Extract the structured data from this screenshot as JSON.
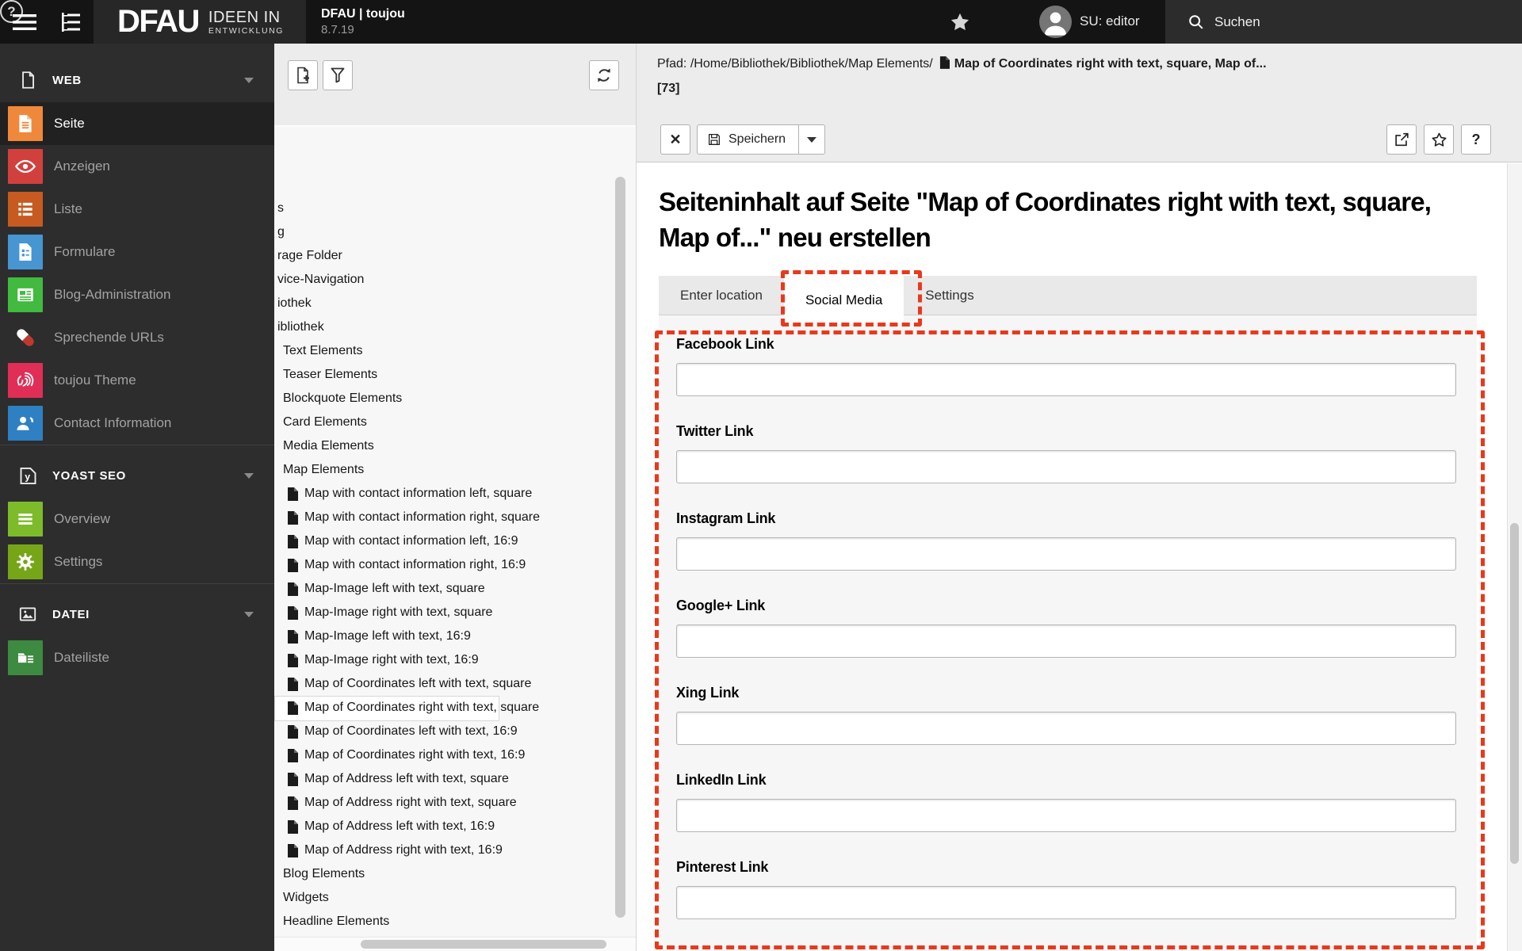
{
  "colors": {
    "annotation_red": "#e8391d"
  },
  "topbar": {
    "logo": {
      "brand": "DFAU",
      "tagline_line1": "IDEEN IN",
      "tagline_line2": "ENTWICKLUNG"
    },
    "site_title": "DFAU | toujou",
    "version": "8.7.19",
    "user_label": "SU: editor",
    "help_glyph": "?",
    "search_label": "Suchen"
  },
  "module_menu": {
    "sections": [
      {
        "label": "WEB",
        "icon": "document-outline-icon",
        "items": [
          {
            "label": "Seite",
            "icon": "page-icon",
            "color": "#f0883b",
            "active": true
          },
          {
            "label": "Anzeigen",
            "icon": "eye-icon",
            "color": "#d2403d",
            "active": false
          },
          {
            "label": "Liste",
            "icon": "list-icon",
            "color": "#c75a20",
            "active": false
          },
          {
            "label": "Formulare",
            "icon": "form-icon",
            "color": "#4795d1",
            "active": false
          },
          {
            "label": "Blog-Administration",
            "icon": "news-icon",
            "color": "#42b93f",
            "active": false
          },
          {
            "label": "Sprechende URLs",
            "icon": "pill-icon",
            "color": "transparent",
            "active": false
          },
          {
            "label": "toujou Theme",
            "icon": "fingerprint-icon",
            "color": "#e02e56",
            "active": false
          },
          {
            "label": "Contact Information",
            "icon": "contact-icon",
            "color": "#2f80c2",
            "active": false
          }
        ]
      },
      {
        "label": "YOAST SEO",
        "icon": "yoast-icon",
        "items": [
          {
            "label": "Overview",
            "icon": "menu-lines-icon",
            "color": "#7dbb2a",
            "active": false
          },
          {
            "label": "Settings",
            "icon": "gear-icon",
            "color": "#76a617",
            "active": false
          }
        ]
      },
      {
        "label": "DATEI",
        "icon": "image-outline-icon",
        "items": [
          {
            "label": "Dateiliste",
            "icon": "filelist-icon",
            "color": "#3d8a41",
            "active": false
          }
        ]
      }
    ]
  },
  "page_tree": {
    "toolbar": [
      {
        "name": "new-page-icon"
      },
      {
        "name": "filter-icon"
      },
      {
        "name": "refresh-icon"
      }
    ],
    "items": [
      {
        "text": "s",
        "kind": "fragment",
        "selected": false
      },
      {
        "text": "g",
        "kind": "fragment",
        "selected": false
      },
      {
        "text": "rage Folder",
        "kind": "fragment",
        "selected": false
      },
      {
        "text": "vice-Navigation",
        "kind": "fragment",
        "selected": false
      },
      {
        "text": "iothek",
        "kind": "fragment",
        "selected": false
      },
      {
        "text": "ibliothek",
        "kind": "fragment",
        "selected": false
      },
      {
        "text": "Text Elements",
        "kind": "group",
        "selected": false
      },
      {
        "text": "Teaser Elements",
        "kind": "group",
        "selected": false
      },
      {
        "text": "Blockquote Elements",
        "kind": "group",
        "selected": false
      },
      {
        "text": "Card Elements",
        "kind": "group",
        "selected": false
      },
      {
        "text": "Media Elements",
        "kind": "group",
        "selected": false
      },
      {
        "text": "Map Elements",
        "kind": "group",
        "selected": false
      },
      {
        "text": "Map with contact information left, square",
        "kind": "leaf",
        "selected": false
      },
      {
        "text": "Map with contact information right, square",
        "kind": "leaf",
        "selected": false
      },
      {
        "text": "Map with contact information left, 16:9",
        "kind": "leaf",
        "selected": false
      },
      {
        "text": "Map with contact information right, 16:9",
        "kind": "leaf",
        "selected": false
      },
      {
        "text": "Map-Image left with text, square",
        "kind": "leaf",
        "selected": false
      },
      {
        "text": "Map-Image right with text, square",
        "kind": "leaf",
        "selected": false
      },
      {
        "text": "Map-Image left with text, 16:9",
        "kind": "leaf",
        "selected": false
      },
      {
        "text": "Map-Image right with text, 16:9",
        "kind": "leaf",
        "selected": false
      },
      {
        "text": "Map of Coordinates left with text, square",
        "kind": "leaf",
        "selected": false
      },
      {
        "text": "Map of Coordinates right with text, square",
        "kind": "leaf",
        "selected": true
      },
      {
        "text": "Map of Coordinates left with text, 16:9",
        "kind": "leaf",
        "selected": false
      },
      {
        "text": "Map of Coordinates right with text, 16:9",
        "kind": "leaf",
        "selected": false
      },
      {
        "text": "Map of Address left with text, square",
        "kind": "leaf",
        "selected": false
      },
      {
        "text": "Map of Address right with text, square",
        "kind": "leaf",
        "selected": false
      },
      {
        "text": "Map of Address left with text, 16:9",
        "kind": "leaf",
        "selected": false
      },
      {
        "text": "Map of Address right with text, 16:9",
        "kind": "leaf",
        "selected": false
      },
      {
        "text": "Blog Elements",
        "kind": "group",
        "selected": false
      },
      {
        "text": "Widgets",
        "kind": "group",
        "selected": false
      },
      {
        "text": "Headline Elements",
        "kind": "group",
        "selected": false
      }
    ]
  },
  "docheader": {
    "path_label": "Pfad:",
    "path": "/Home/Bibliothek/Bibliothek/Map Elements/",
    "record_title": "Map of Coordinates right with text, square, Map of...",
    "record_uid": "[73]",
    "close_glyph": "✕",
    "save_label": "Speichern",
    "help_glyph": "?"
  },
  "content": {
    "heading": "Seiteninhalt auf Seite \"Map of Coordinates right with text, square, Map of...\" neu erstellen",
    "tabs": [
      "Enter location",
      "Social Media",
      "Settings"
    ],
    "active_tab_index": 1,
    "fields": [
      {
        "label": "Facebook Link",
        "value": ""
      },
      {
        "label": "Twitter Link",
        "value": ""
      },
      {
        "label": "Instagram Link",
        "value": ""
      },
      {
        "label": "Google+ Link",
        "value": ""
      },
      {
        "label": "Xing Link",
        "value": ""
      },
      {
        "label": "LinkedIn Link",
        "value": ""
      },
      {
        "label": "Pinterest Link",
        "value": ""
      }
    ]
  }
}
